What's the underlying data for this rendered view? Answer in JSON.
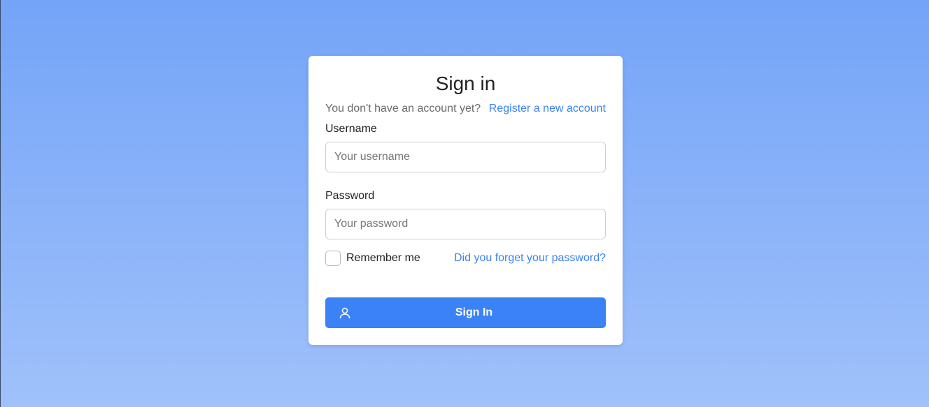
{
  "signin": {
    "title": "Sign in",
    "no_account_text": "You don't have an account yet?",
    "register_link": "Register a new account",
    "username_label": "Username",
    "username_placeholder": "Your username",
    "username_value": "",
    "password_label": "Password",
    "password_placeholder": "Your password",
    "password_value": "",
    "remember_label": "Remember me",
    "remember_checked": false,
    "forgot_link": "Did you forget your password?",
    "submit_label": "Sign In",
    "submit_icon": "user-icon"
  },
  "colors": {
    "accent": "#3b82f6",
    "background_top": "#74a4f8",
    "background_bottom": "#a0c1fa",
    "card": "#ffffff"
  }
}
